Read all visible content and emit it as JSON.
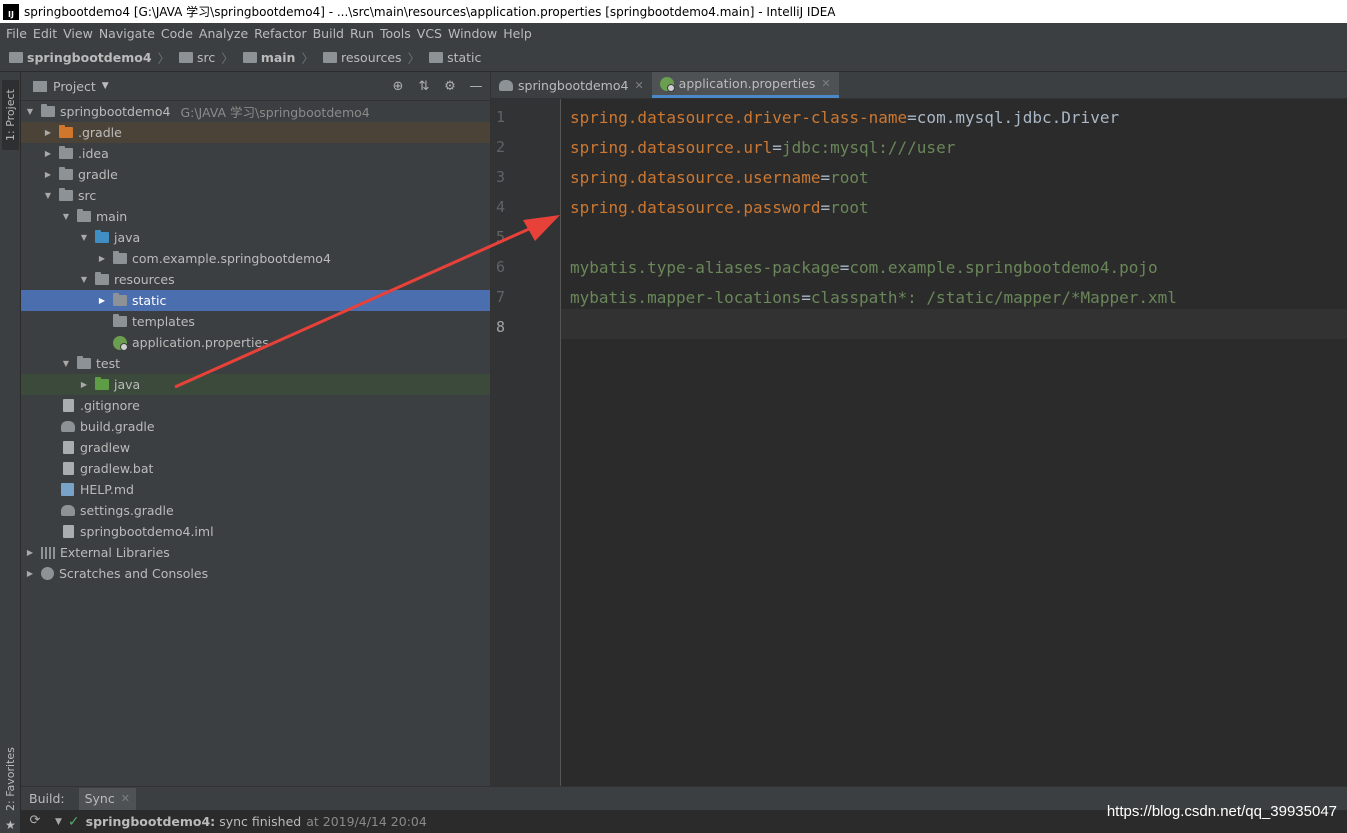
{
  "window": {
    "title": "springbootdemo4 [G:\\JAVA 学习\\springbootdemo4] - ...\\src\\main\\resources\\application.properties [springbootdemo4.main] - IntelliJ IDEA",
    "logo_text": "IJ"
  },
  "menu": [
    "File",
    "Edit",
    "View",
    "Navigate",
    "Code",
    "Analyze",
    "Refactor",
    "Build",
    "Run",
    "Tools",
    "VCS",
    "Window",
    "Help"
  ],
  "breadcrumb": [
    "springbootdemo4",
    "src",
    "main",
    "resources",
    "static"
  ],
  "left_tool": {
    "project_tab": "1: Project",
    "favorites_tab": "2: Favorites"
  },
  "project_panel": {
    "title": "Project",
    "tree": [
      {
        "label": "springbootdemo4",
        "path": "G:\\JAVA 学习\\springbootdemo4"
      },
      {
        "label": ".gradle"
      },
      {
        "label": ".idea"
      },
      {
        "label": "gradle"
      },
      {
        "label": "src"
      },
      {
        "label": "main"
      },
      {
        "label": "java"
      },
      {
        "label": "com.example.springbootdemo4"
      },
      {
        "label": "resources"
      },
      {
        "label": "static"
      },
      {
        "label": "templates"
      },
      {
        "label": "application.properties"
      },
      {
        "label": "test"
      },
      {
        "label": "java"
      },
      {
        "label": ".gitignore"
      },
      {
        "label": "build.gradle"
      },
      {
        "label": "gradlew"
      },
      {
        "label": "gradlew.bat"
      },
      {
        "label": "HELP.md"
      },
      {
        "label": "settings.gradle"
      },
      {
        "label": "springbootdemo4.iml"
      },
      {
        "label": "External Libraries"
      },
      {
        "label": "Scratches and Consoles"
      }
    ]
  },
  "editor": {
    "tabs": [
      {
        "label": "springbootdemo4"
      },
      {
        "label": "application.properties"
      }
    ],
    "lines": [
      {
        "n": "1",
        "key": "spring.datasource.driver-class-name",
        "value": "com.mysql.jdbc.Driver"
      },
      {
        "n": "2",
        "key": "spring.datasource.url",
        "value": "jdbc:mysql:///user"
      },
      {
        "n": "3",
        "key": "spring.datasource.username",
        "value": "root"
      },
      {
        "n": "4",
        "key": "spring.datasource.password",
        "value": "root"
      },
      {
        "n": "5",
        "key": "",
        "value": ""
      },
      {
        "n": "6",
        "key": "mybatis.type-aliases-package",
        "value": "com.example.springbootdemo4.pojo"
      },
      {
        "n": "7",
        "key": "mybatis.mapper-locations",
        "value": "classpath*: /static/mapper/*Mapper.xml"
      },
      {
        "n": "8",
        "key": "",
        "value": ""
      }
    ],
    "eq": "="
  },
  "build": {
    "label": "Build:",
    "tab": "Sync",
    "project": "springbootdemo4:",
    "message": "sync finished",
    "timestamp": "at 2019/4/14 20:04"
  },
  "watermark": "https://blog.csdn.net/qq_39935047",
  "colors": {
    "selection": "#4b6eaf",
    "test_java_bg": "#3c4a3b",
    "gradle_bg": "#4b4338",
    "arrow": "#e8413a"
  }
}
